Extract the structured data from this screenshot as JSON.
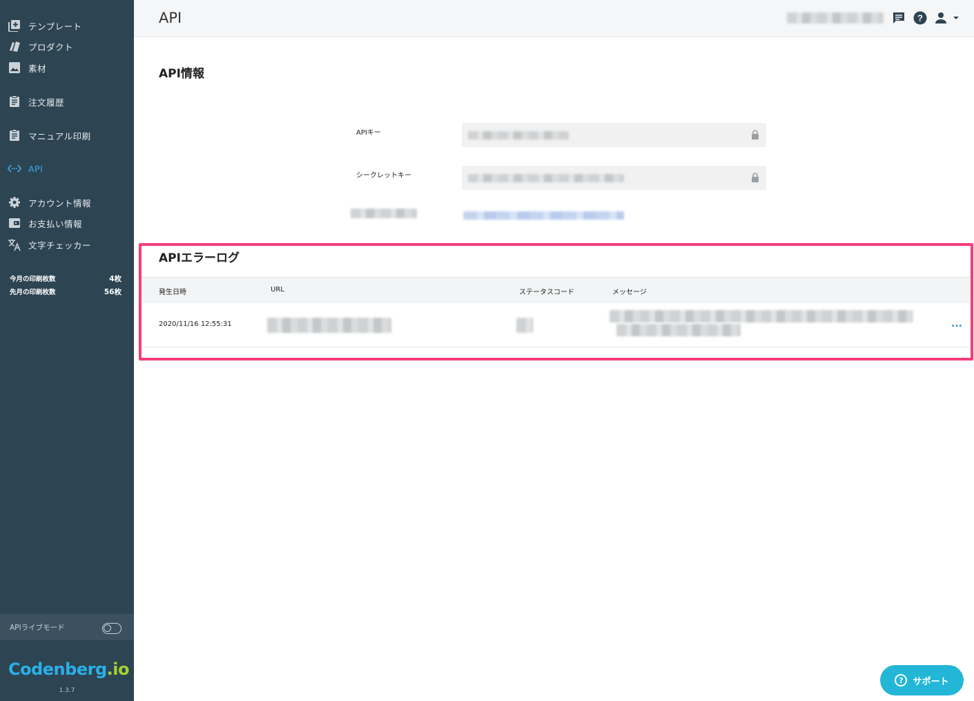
{
  "sidebar": {
    "items": [
      {
        "label": "テンプレート",
        "icon": "add-box-icon"
      },
      {
        "label": "プロダクト",
        "icon": "product-icon"
      },
      {
        "label": "素材",
        "icon": "image-icon"
      },
      {
        "label": "注文履歴",
        "icon": "clipboard-icon"
      },
      {
        "label": "マニュアル印刷",
        "icon": "clipboard-icon"
      },
      {
        "label": "API",
        "icon": "code-icon",
        "active": true
      },
      {
        "label": "アカウント情報",
        "icon": "gear-icon"
      },
      {
        "label": "お支払い情報",
        "icon": "wallet-icon"
      },
      {
        "label": "文字チェッカー",
        "icon": "translate-icon"
      }
    ],
    "stats": [
      {
        "label": "今月の印刷枚数",
        "value": "4枚"
      },
      {
        "label": "先月の印刷枚数",
        "value": "56枚"
      }
    ],
    "live_mode_label": "APIライブモード",
    "live_mode_on": false,
    "logo_main": "Codenberg",
    "logo_suffix": ".io",
    "version": "1.3.7"
  },
  "header": {
    "title": "API"
  },
  "api_info": {
    "title": "API情報",
    "api_key_label": "APIキー",
    "secret_key_label": "シークレットキー"
  },
  "error_log": {
    "title": "APIエラーログ",
    "columns": [
      "発生日時",
      "URL",
      "ステータスコード",
      "メッセージ"
    ],
    "rows": [
      {
        "date": "2020/11/16 12:55:31"
      }
    ],
    "more_label": "..."
  },
  "support": {
    "label": "サポート"
  },
  "colors": {
    "sidebar_bg": "#2d4452",
    "accent": "#3fa8e6",
    "highlight": "#f53d7a",
    "support_bg": "#23b6d6"
  }
}
